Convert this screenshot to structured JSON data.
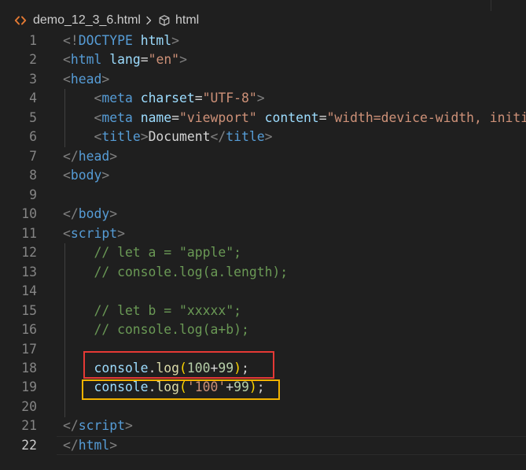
{
  "breadcrumb": {
    "file_icon": "html-file-icon",
    "file_name": "demo_12_3_6.html",
    "separator_icon": "chevron-right-icon",
    "symbol_icon": "symbol-field-icon",
    "symbol_name": "html"
  },
  "colors": {
    "background": "#1f1f1f",
    "line_number": "#858585",
    "line_number_active": "#cccccc",
    "indent_guide": "#404040",
    "line_highlight_border": "#2b2b2b",
    "breadcrumb_text": "#cccccc",
    "file_icon": "#e37933",
    "symbol_icon": "#c5c5c5",
    "annotation_red": "#e53935",
    "annotation_yellow": "#f2b300"
  },
  "editor": {
    "lines": [
      {
        "number": "1",
        "tokens": [
          {
            "text": "<!",
            "color": "#808080"
          },
          {
            "text": "DOCTYPE",
            "color": "#569cd6"
          },
          {
            "text": " html",
            "color": "#9cdcfe"
          },
          {
            "text": ">",
            "color": "#808080"
          }
        ]
      },
      {
        "number": "2",
        "tokens": [
          {
            "text": "<",
            "color": "#808080"
          },
          {
            "text": "html",
            "color": "#569cd6"
          },
          {
            "text": " lang",
            "color": "#9cdcfe"
          },
          {
            "text": "=",
            "color": "#d4d4d4"
          },
          {
            "text": "\"en\"",
            "color": "#ce9178"
          },
          {
            "text": ">",
            "color": "#808080"
          }
        ]
      },
      {
        "number": "3",
        "tokens": [
          {
            "text": "<",
            "color": "#808080"
          },
          {
            "text": "head",
            "color": "#569cd6"
          },
          {
            "text": ">",
            "color": "#808080"
          }
        ]
      },
      {
        "number": "4",
        "tokens": [
          {
            "text": "    <",
            "color": "#808080"
          },
          {
            "text": "meta",
            "color": "#569cd6"
          },
          {
            "text": " charset",
            "color": "#9cdcfe"
          },
          {
            "text": "=",
            "color": "#d4d4d4"
          },
          {
            "text": "\"UTF-8\"",
            "color": "#ce9178"
          },
          {
            "text": ">",
            "color": "#808080"
          }
        ]
      },
      {
        "number": "5",
        "tokens": [
          {
            "text": "    <",
            "color": "#808080"
          },
          {
            "text": "meta",
            "color": "#569cd6"
          },
          {
            "text": " name",
            "color": "#9cdcfe"
          },
          {
            "text": "=",
            "color": "#d4d4d4"
          },
          {
            "text": "\"viewport\"",
            "color": "#ce9178"
          },
          {
            "text": " content",
            "color": "#9cdcfe"
          },
          {
            "text": "=",
            "color": "#d4d4d4"
          },
          {
            "text": "\"width=device-width, initi",
            "color": "#ce9178"
          }
        ]
      },
      {
        "number": "6",
        "tokens": [
          {
            "text": "    <",
            "color": "#808080"
          },
          {
            "text": "title",
            "color": "#569cd6"
          },
          {
            "text": ">",
            "color": "#808080"
          },
          {
            "text": "Document",
            "color": "#d4d4d4"
          },
          {
            "text": "</",
            "color": "#808080"
          },
          {
            "text": "title",
            "color": "#569cd6"
          },
          {
            "text": ">",
            "color": "#808080"
          }
        ]
      },
      {
        "number": "7",
        "tokens": [
          {
            "text": "</",
            "color": "#808080"
          },
          {
            "text": "head",
            "color": "#569cd6"
          },
          {
            "text": ">",
            "color": "#808080"
          }
        ]
      },
      {
        "number": "8",
        "tokens": [
          {
            "text": "<",
            "color": "#808080"
          },
          {
            "text": "body",
            "color": "#569cd6"
          },
          {
            "text": ">",
            "color": "#808080"
          }
        ]
      },
      {
        "number": "9",
        "tokens": []
      },
      {
        "number": "10",
        "tokens": [
          {
            "text": "</",
            "color": "#808080"
          },
          {
            "text": "body",
            "color": "#569cd6"
          },
          {
            "text": ">",
            "color": "#808080"
          }
        ]
      },
      {
        "number": "11",
        "tokens": [
          {
            "text": "<",
            "color": "#808080"
          },
          {
            "text": "script",
            "color": "#569cd6"
          },
          {
            "text": ">",
            "color": "#808080"
          }
        ]
      },
      {
        "number": "12",
        "tokens": [
          {
            "text": "    // let a = \"apple\";",
            "color": "#6a9955"
          }
        ]
      },
      {
        "number": "13",
        "tokens": [
          {
            "text": "    // console.log(a.length);",
            "color": "#6a9955"
          }
        ]
      },
      {
        "number": "14",
        "tokens": []
      },
      {
        "number": "15",
        "tokens": [
          {
            "text": "    // let b = \"xxxxx\";",
            "color": "#6a9955"
          }
        ]
      },
      {
        "number": "16",
        "tokens": [
          {
            "text": "    // console.log(a+b);",
            "color": "#6a9955"
          }
        ]
      },
      {
        "number": "17",
        "tokens": []
      },
      {
        "number": "18",
        "tokens": [
          {
            "text": "    console",
            "color": "#9cdcfe"
          },
          {
            "text": ".",
            "color": "#d4d4d4"
          },
          {
            "text": "log",
            "color": "#dcdcaa"
          },
          {
            "text": "(",
            "color": "#ffd700"
          },
          {
            "text": "100",
            "color": "#b5cea8"
          },
          {
            "text": "+",
            "color": "#d4d4d4"
          },
          {
            "text": "99",
            "color": "#b5cea8"
          },
          {
            "text": ")",
            "color": "#ffd700"
          },
          {
            "text": ";",
            "color": "#d4d4d4"
          }
        ]
      },
      {
        "number": "19",
        "tokens": [
          {
            "text": "    console",
            "color": "#9cdcfe"
          },
          {
            "text": ".",
            "color": "#d4d4d4"
          },
          {
            "text": "log",
            "color": "#dcdcaa"
          },
          {
            "text": "(",
            "color": "#ffd700"
          },
          {
            "text": "'100'",
            "color": "#ce9178"
          },
          {
            "text": "+",
            "color": "#d4d4d4"
          },
          {
            "text": "99",
            "color": "#b5cea8"
          },
          {
            "text": ")",
            "color": "#ffd700"
          },
          {
            "text": ";",
            "color": "#d4d4d4"
          }
        ]
      },
      {
        "number": "20",
        "tokens": []
      },
      {
        "number": "21",
        "tokens": [
          {
            "text": "</",
            "color": "#808080"
          },
          {
            "text": "script",
            "color": "#569cd6"
          },
          {
            "text": ">",
            "color": "#808080"
          }
        ]
      },
      {
        "number": "22",
        "active": true,
        "tokens": [
          {
            "text": "</",
            "color": "#808080"
          },
          {
            "text": "html",
            "color": "#569cd6"
          },
          {
            "text": ">",
            "color": "#808080"
          }
        ]
      }
    ]
  }
}
